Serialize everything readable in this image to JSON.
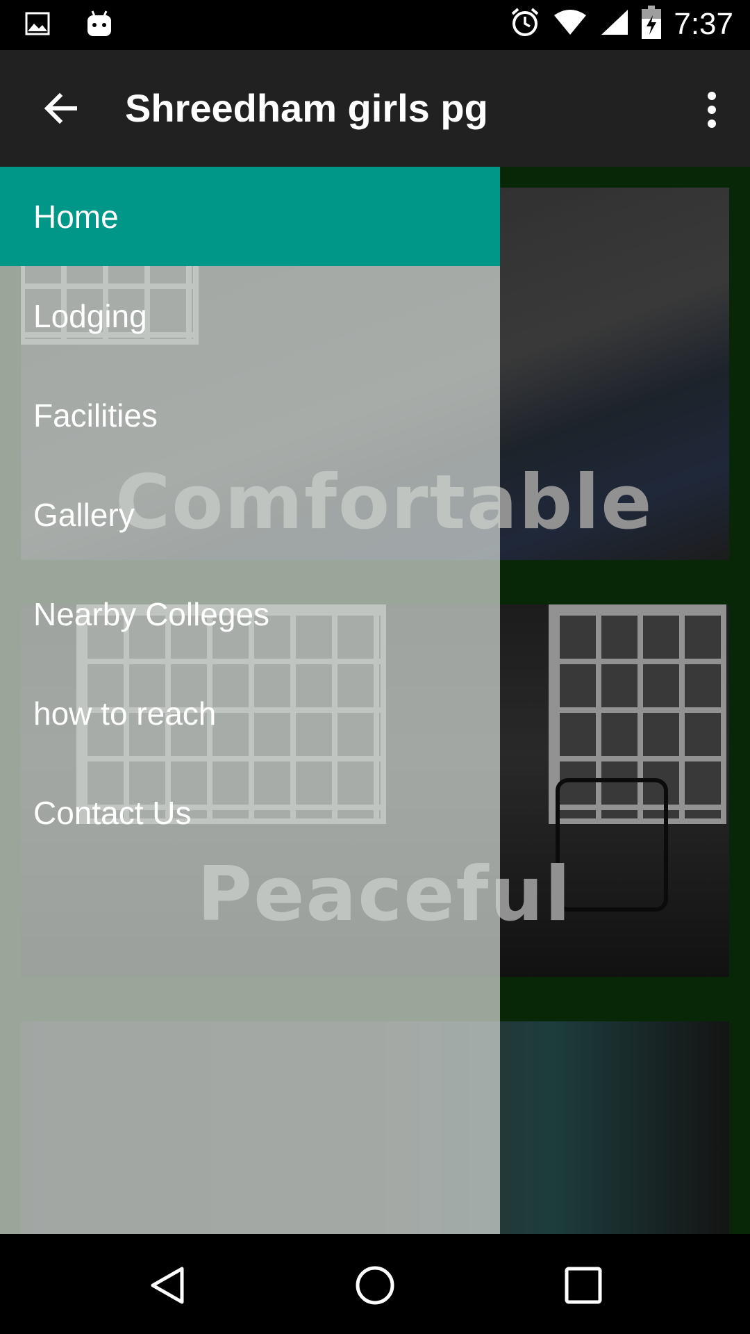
{
  "status_bar": {
    "time": "7:37",
    "left_icons": [
      "image-icon",
      "android-icon"
    ],
    "right_icons": [
      "alarm-icon",
      "wifi-icon",
      "signal-icon",
      "battery-charging-icon"
    ]
  },
  "app_bar": {
    "title": "Shreedham girls pg",
    "back_icon": "arrow-back-icon",
    "overflow_icon": "more-vert-icon"
  },
  "drawer": {
    "items": [
      {
        "label": "Home",
        "active": true
      },
      {
        "label": "Lodging",
        "active": false
      },
      {
        "label": "Facilities",
        "active": false
      },
      {
        "label": "Gallery",
        "active": false
      },
      {
        "label": "Nearby Colleges",
        "active": false
      },
      {
        "label": "how to reach",
        "active": false
      },
      {
        "label": "Contact Us",
        "active": false
      }
    ]
  },
  "cards": [
    {
      "caption": "Comfortable"
    },
    {
      "caption": "Peaceful"
    },
    {
      "caption": ""
    }
  ],
  "nav_bar": {
    "icons": [
      "nav-back-icon",
      "nav-home-icon",
      "nav-recents-icon"
    ]
  },
  "colors": {
    "app_bar": "#212121",
    "drawer_active": "#009688",
    "content_bg": "#0c3a0a"
  }
}
